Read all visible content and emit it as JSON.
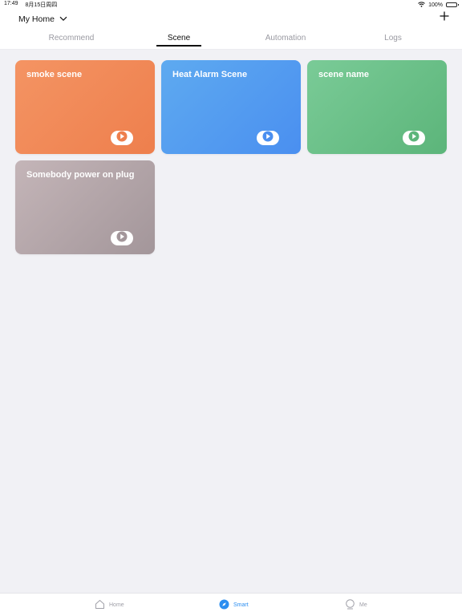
{
  "status_bar": {
    "time": "17:49",
    "date": "8月15日周四",
    "battery": "100%",
    "battery_level": 1.0
  },
  "header": {
    "home_name": "My Home",
    "add_icon": "plus-icon"
  },
  "tabs": [
    {
      "label": "Recommend",
      "active": false
    },
    {
      "label": "Scene",
      "active": true
    },
    {
      "label": "Automation",
      "active": false
    },
    {
      "label": "Logs",
      "active": false
    }
  ],
  "scenes": [
    {
      "name": "smoke scene",
      "color": "#ee7f4d"
    },
    {
      "name": "Heat Alarm Scene",
      "color": "#4a8ff0"
    },
    {
      "name": "scene name",
      "color": "#5cb57a"
    },
    {
      "name": "Somebody power on plug",
      "color": "#a3969a"
    }
  ],
  "bottom_nav": [
    {
      "label": "Home",
      "icon": "house-icon",
      "active": false
    },
    {
      "label": "Smart",
      "icon": "compass-icon",
      "active": true
    },
    {
      "label": "Me",
      "icon": "person-icon",
      "active": false
    }
  ],
  "colors": {
    "accent": "#2b8ef0",
    "background": "#f1f1f5"
  }
}
